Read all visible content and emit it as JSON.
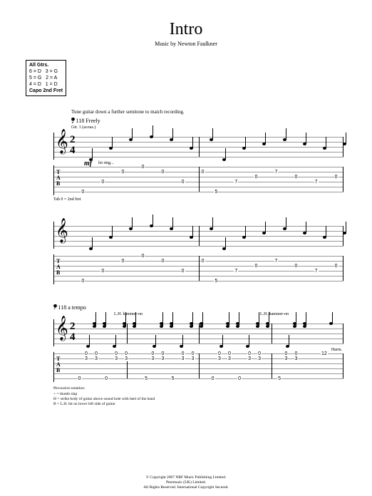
{
  "title": "Intro",
  "subtitle": "Music by Newton Faulkner",
  "tuning": {
    "header": "All Gtrs.",
    "rows": [
      "6 = D   3 = G",
      "5 = G   2 = A",
      "4 = D   1 = D"
    ],
    "capo": "Capo 2nd Fret"
  },
  "instruction": "Tune guitar down a further semitone to match recording.",
  "tempo1": {
    "marking": "= 118 Freely"
  },
  "gtr_label": "Gtr. 1 (acous.)",
  "time_sig": {
    "top": "2",
    "bottom": "4"
  },
  "dynamics": {
    "mf": "mf",
    "letring": "let ring..."
  },
  "tab_note": "Tab 0 = 2nd fret",
  "tempo2": {
    "marking": "= 118 a tempo"
  },
  "lh_hammer": "L.H. hammer-on",
  "harm_label": "Harm.",
  "systems": [
    {
      "bars": [
        {
          "frets": [
            {
              "s": 6,
              "f": "0",
              "x": 5
            },
            {
              "s": 4,
              "f": "0",
              "x": 20
            },
            {
              "s": 2,
              "f": "0",
              "x": 35
            },
            {
              "s": 1,
              "f": "0",
              "x": 50
            },
            {
              "s": 2,
              "f": "0",
              "x": 65
            },
            {
              "s": 4,
              "f": "0",
              "x": 80
            },
            {
              "s": 2,
              "f": "0",
              "x": 95
            }
          ]
        },
        {
          "frets": [
            {
              "s": 6,
              "f": "5",
              "x": 5
            },
            {
              "s": 4,
              "f": "7",
              "x": 20
            },
            {
              "s": 3,
              "f": "0",
              "x": 35
            },
            {
              "s": 2,
              "f": "7",
              "x": 50
            },
            {
              "s": 3,
              "f": "0",
              "x": 65
            },
            {
              "s": 4,
              "f": "7",
              "x": 80
            },
            {
              "s": 3,
              "f": "0",
              "x": 95
            }
          ]
        }
      ]
    },
    {
      "bars": [
        {
          "frets": [
            {
              "s": 6,
              "f": "0",
              "x": 5
            },
            {
              "s": 4,
              "f": "0",
              "x": 20
            },
            {
              "s": 2,
              "f": "0",
              "x": 35
            },
            {
              "s": 1,
              "f": "0",
              "x": 50
            },
            {
              "s": 2,
              "f": "0",
              "x": 65
            },
            {
              "s": 4,
              "f": "0",
              "x": 80
            },
            {
              "s": 2,
              "f": "0",
              "x": 95
            }
          ]
        },
        {
          "frets": [
            {
              "s": 6,
              "f": "5",
              "x": 5
            },
            {
              "s": 4,
              "f": "7",
              "x": 20
            },
            {
              "s": 3,
              "f": "0",
              "x": 35
            },
            {
              "s": 2,
              "f": "7",
              "x": 50
            },
            {
              "s": 3,
              "f": "0",
              "x": 65
            },
            {
              "s": 4,
              "f": "7",
              "x": 80
            },
            {
              "s": 3,
              "f": "0",
              "x": 95
            }
          ]
        }
      ]
    },
    {
      "bars": [
        {
          "frets": [
            {
              "s": 6,
              "f": "0",
              "x": 5
            },
            {
              "s": 2,
              "f": "3",
              "x": 15
            },
            {
              "s": 1,
              "f": "0",
              "x": 15
            },
            {
              "s": 2,
              "f": "3",
              "x": 30
            },
            {
              "s": 1,
              "f": "0",
              "x": 30
            },
            {
              "s": 6,
              "f": "0",
              "x": 45
            },
            {
              "s": 2,
              "f": "3",
              "x": 60
            },
            {
              "s": 1,
              "f": "0",
              "x": 60
            },
            {
              "s": 2,
              "f": "3",
              "x": 75
            },
            {
              "s": 1,
              "f": "0",
              "x": 75
            }
          ]
        },
        {
          "frets": [
            {
              "s": 6,
              "f": "5",
              "x": 5
            },
            {
              "s": 2,
              "f": "3",
              "x": 15
            },
            {
              "s": 1,
              "f": "0",
              "x": 15
            },
            {
              "s": 2,
              "f": "3",
              "x": 30
            },
            {
              "s": 1,
              "f": "0",
              "x": 30
            },
            {
              "s": 6,
              "f": "5",
              "x": 45
            },
            {
              "s": 2,
              "f": "3",
              "x": 60
            },
            {
              "s": 1,
              "f": "0",
              "x": 60
            },
            {
              "s": 2,
              "f": "3",
              "x": 75
            },
            {
              "s": 1,
              "f": "0",
              "x": 75
            }
          ]
        },
        {
          "frets": [
            {
              "s": 6,
              "f": "0",
              "x": 5
            },
            {
              "s": 2,
              "f": "3",
              "x": 15
            },
            {
              "s": 1,
              "f": "0",
              "x": 15
            },
            {
              "s": 2,
              "f": "3",
              "x": 30
            },
            {
              "s": 1,
              "f": "0",
              "x": 30
            },
            {
              "s": 6,
              "f": "0",
              "x": 45
            },
            {
              "s": 2,
              "f": "3",
              "x": 60
            },
            {
              "s": 1,
              "f": "0",
              "x": 60
            },
            {
              "s": 2,
              "f": "3",
              "x": 75
            },
            {
              "s": 1,
              "f": "0",
              "x": 75
            }
          ]
        },
        {
          "frets": [
            {
              "s": 6,
              "f": "5",
              "x": 5
            },
            {
              "s": 2,
              "f": "3",
              "x": 15
            },
            {
              "s": 1,
              "f": "0",
              "x": 15
            },
            {
              "s": 2,
              "f": "3",
              "x": 30
            },
            {
              "s": 1,
              "f": "0",
              "x": 30
            },
            {
              "s": 1,
              "f": "12",
              "x": 70
            }
          ]
        }
      ]
    }
  ],
  "perc_legend": {
    "title": "Percussive notation:",
    "lines": [
      "+ = thumb slap",
      "H = strike body of guitar above sound hole with heel of the hand",
      "B = L.H. hit on lower left side of guitar"
    ]
  },
  "copyright": [
    "© Copyright 2007 NBF Music Publishing Limited.",
    "Peermusic (UK) Limited.",
    "All Rights Reserved. International Copyright Secured."
  ]
}
